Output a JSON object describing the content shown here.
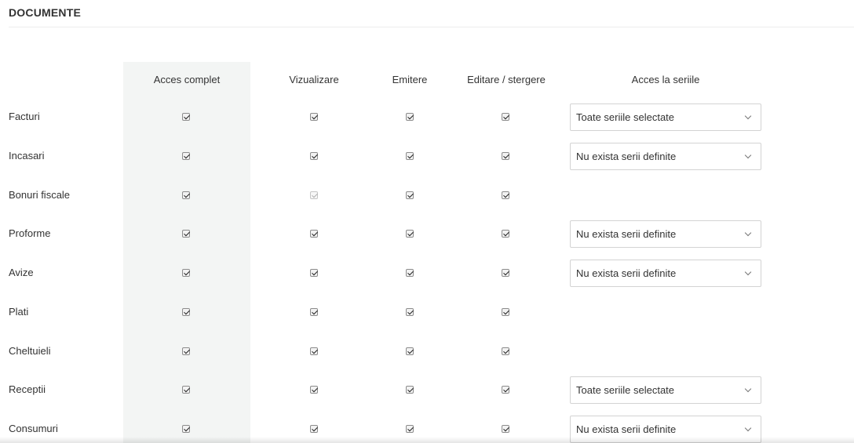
{
  "section": {
    "title": "DOCUMENTE"
  },
  "columns": {
    "full_access": "Acces complet",
    "view": "Vizualizare",
    "issue": "Emitere",
    "edit_delete": "Editare / stergere",
    "series_access": "Acces la seriile"
  },
  "rows": [
    {
      "label": "Facturi",
      "full_access": true,
      "view": true,
      "view_disabled": false,
      "issue": true,
      "edit_delete": true,
      "series": "Toate seriile selectate"
    },
    {
      "label": "Incasari",
      "full_access": true,
      "view": true,
      "view_disabled": false,
      "issue": true,
      "edit_delete": true,
      "series": "Nu exista serii definite"
    },
    {
      "label": "Bonuri fiscale",
      "full_access": true,
      "view": true,
      "view_disabled": true,
      "issue": true,
      "edit_delete": true,
      "series": null
    },
    {
      "label": "Proforme",
      "full_access": true,
      "view": true,
      "view_disabled": false,
      "issue": true,
      "edit_delete": true,
      "series": "Nu exista serii definite"
    },
    {
      "label": "Avize",
      "full_access": true,
      "view": true,
      "view_disabled": false,
      "issue": true,
      "edit_delete": true,
      "series": "Nu exista serii definite"
    },
    {
      "label": "Plati",
      "full_access": true,
      "view": true,
      "view_disabled": false,
      "issue": true,
      "edit_delete": true,
      "series": null
    },
    {
      "label": "Cheltuieli",
      "full_access": true,
      "view": true,
      "view_disabled": false,
      "issue": true,
      "edit_delete": true,
      "series": null
    },
    {
      "label": "Receptii",
      "full_access": true,
      "view": true,
      "view_disabled": false,
      "issue": true,
      "edit_delete": true,
      "series": "Toate seriile selectate"
    },
    {
      "label": "Consumuri",
      "full_access": true,
      "view": true,
      "view_disabled": false,
      "issue": true,
      "edit_delete": true,
      "series": "Nu exista serii definite"
    }
  ],
  "icons": {
    "select_arrow": "chevron-down-icon"
  },
  "colors": {
    "shaded_column": "#f3f5f4",
    "divider": "#ececec",
    "select_border": "#d3d3d3"
  }
}
